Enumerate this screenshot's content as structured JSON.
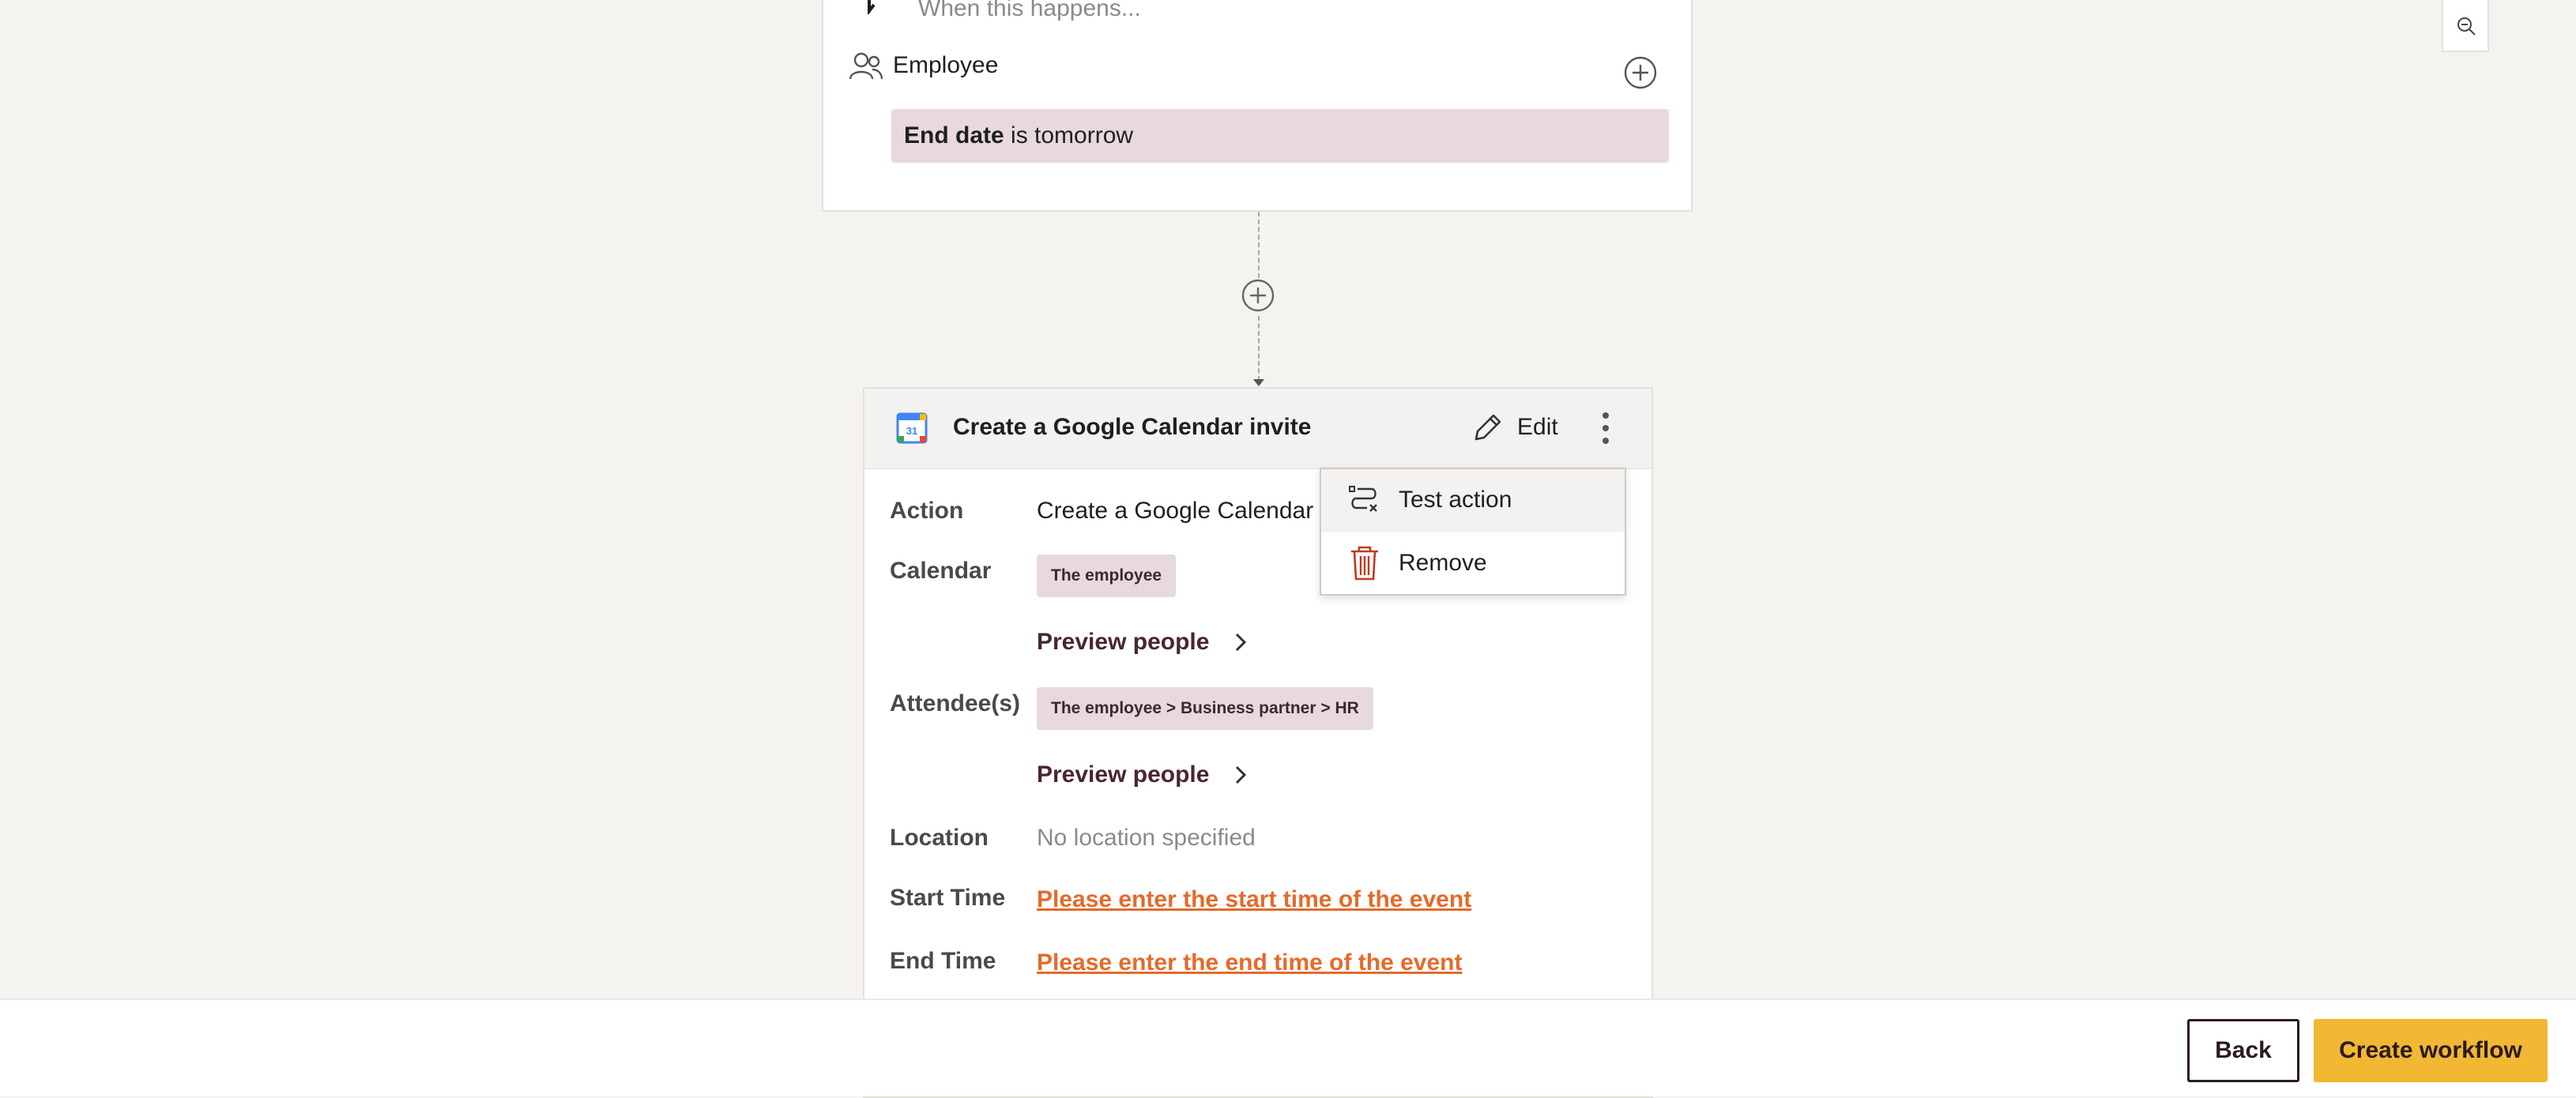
{
  "trigger": {
    "placeholder": "When this happens...",
    "entity_label": "Employee",
    "condition_field": "End date",
    "condition_text": " is tomorrow"
  },
  "action": {
    "title": "Create a Google Calendar invite",
    "edit_label": "Edit",
    "fields": {
      "action_label": "Action",
      "action_value": "Create a Google Calendar",
      "calendar_label": "Calendar",
      "calendar_tag": "The employee",
      "preview_label_1": "Preview people",
      "attendees_label": "Attendee(s)",
      "attendees_tag": "The employee > Business partner > HR",
      "preview_label_2": "Preview people",
      "location_label": "Location",
      "location_value": "No location specified",
      "start_label": "Start Time",
      "start_value": "Please enter the start time of the event",
      "end_label": "End Time",
      "end_value": "Please enter the end time of the event"
    }
  },
  "menu": {
    "items": [
      {
        "label": "Test action",
        "icon": "test-action-icon"
      },
      {
        "label": "Remove",
        "icon": "trash-icon"
      }
    ]
  },
  "footer": {
    "back_label": "Back",
    "create_label": "Create workflow"
  },
  "colors": {
    "accent": "#f2b733",
    "tag_bg": "#e7d9de",
    "warning_link": "#e36b2b",
    "remove_icon": "#c0391b"
  }
}
